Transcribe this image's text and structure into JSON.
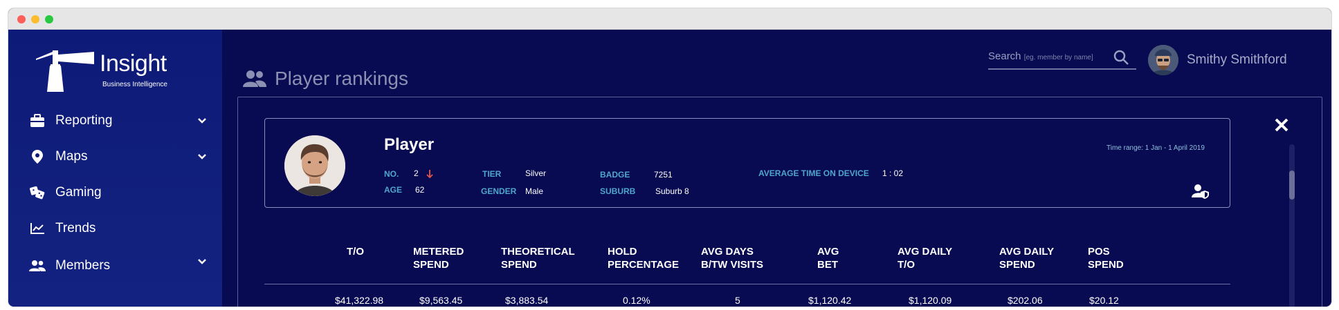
{
  "app": {
    "logo_name": "Insight",
    "logo_subtitle": "Business Intelligence",
    "accent": "#080a52",
    "sidebar_color": "#0e1a78",
    "label_color": "#4fa6cb"
  },
  "sidebar": {
    "items": [
      {
        "label": "Reporting",
        "icon": "briefcase-icon",
        "expandable": true
      },
      {
        "label": "Maps",
        "icon": "map-pin-icon",
        "expandable": true
      },
      {
        "label": "Gaming",
        "icon": "dice-icon",
        "expandable": false
      },
      {
        "label": "Trends",
        "icon": "trend-chart-icon",
        "expandable": false
      },
      {
        "label": "Members",
        "icon": "members-icon",
        "expandable": true
      }
    ]
  },
  "header": {
    "page_title": "Player rankings",
    "search_label": "Search",
    "search_hint": "[eg. member by name]",
    "user_name": "Smithy Smithford"
  },
  "player": {
    "title": "Player",
    "time_range": "Time range: 1 Jan - 1 April 2019",
    "fields": {
      "no_label": "NO.",
      "no_value": "2",
      "age_label": "AGE",
      "age_value": "62",
      "tier_label": "TIER",
      "tier_value": "Silver",
      "gender_label": "GENDER",
      "gender_value": "Male",
      "badge_label": "BADGE",
      "badge_value": "7251",
      "suburb_label": "SUBURB",
      "suburb_value": "Suburb 8",
      "avg_time_label": "AVERAGE TIME ON DEVICE",
      "avg_time_value": "1 : 02"
    }
  },
  "stats": {
    "headers": [
      [
        "T/O",
        ""
      ],
      [
        "METERED",
        "SPEND"
      ],
      [
        "THEORETICAL",
        "SPEND"
      ],
      [
        "HOLD",
        "PERCENTAGE"
      ],
      [
        "AVG DAYS",
        "B/TW VISITS"
      ],
      [
        "AVG",
        "BET"
      ],
      [
        "AVG DAILY",
        "T/O"
      ],
      [
        "AVG DAILY",
        "SPEND"
      ],
      [
        "POS",
        "SPEND"
      ]
    ],
    "values": [
      "$41,322.98",
      "$9,563.45",
      "$3,883.54",
      "0.12%",
      "5",
      "$1,120.42",
      "$1,120.09",
      "$202.06",
      "$20.12"
    ]
  }
}
